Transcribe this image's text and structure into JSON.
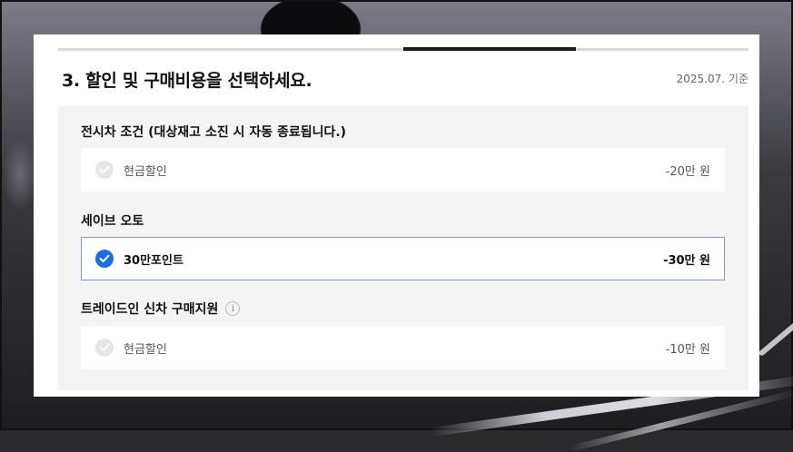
{
  "step": {
    "title": "3. 할인 및 구매비용을 선택하세요.",
    "date_note": "2025.07. 기준",
    "progress_fill_fraction_start": 0.5,
    "progress_fill_fraction_end": 0.75
  },
  "sections": [
    {
      "title": "전시차 조건 (대상재고 소진 시 자동 종료됩니다.)",
      "info_icon": false,
      "option": {
        "label": "현금할인",
        "amount": "-20만 원",
        "selected": false
      }
    },
    {
      "title": "세이브 오토",
      "info_icon": false,
      "option": {
        "label": "30만포인트",
        "amount": "-30만 원",
        "selected": true
      }
    },
    {
      "title": "트레이드인 신차 구매지원",
      "info_icon": true,
      "info_glyph": "i",
      "option": {
        "label": "현금할인",
        "amount": "-10만 원",
        "selected": false
      }
    }
  ],
  "colors": {
    "accent": "#1a6fe0",
    "selected_border": "#7f9bd6",
    "panel_bg": "#f4f4f4",
    "check_off": "#e6e6e6"
  },
  "icons": {
    "check": "check-circle-icon",
    "info": "info-icon"
  }
}
